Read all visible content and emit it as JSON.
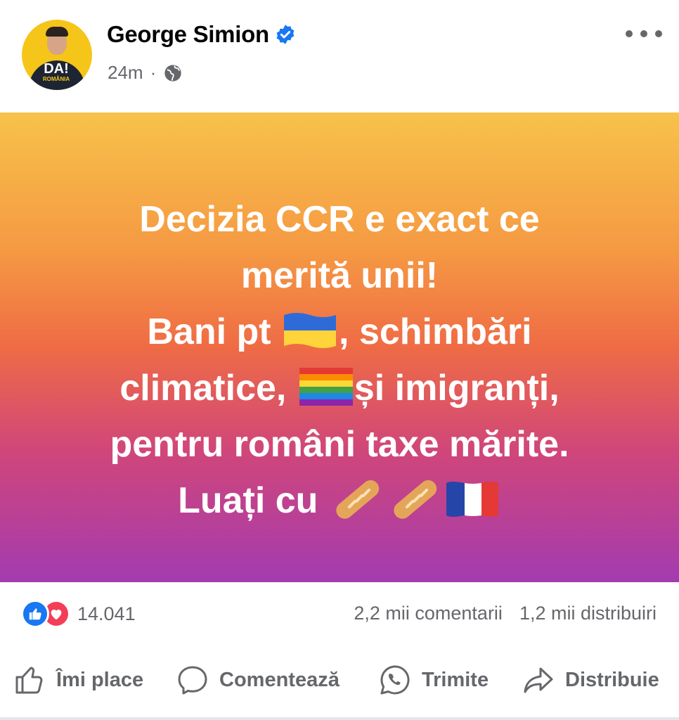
{
  "post": {
    "author": "George Simion",
    "time": "24m",
    "avatar_text": "DA!",
    "avatar_subtext": "ROMÂNIA",
    "lines": [
      "Decizia CCR e exact ce",
      "merită unii!",
      "Bani pt",
      ", schimbări",
      "climatice,",
      "și imigranți,",
      "pentru români taxe mărite.",
      "Luați cu"
    ],
    "emoji": {
      "ukraine_flag": "ukraine-flag-emoji",
      "rainbow_flag": "rainbow-flag-emoji",
      "baguette": "baguette-emoji",
      "france_flag": "france-flag-emoji"
    },
    "gradient_colors": [
      "#f7c24a",
      "#f59843",
      "#ef6b45",
      "#d0467a",
      "#a33bb0"
    ]
  },
  "engagement": {
    "reaction_count": "14.041",
    "comments": "2,2 mii comentarii",
    "shares": "1,2 mii distribuiri"
  },
  "actions": {
    "like": "Îmi place",
    "comment": "Comentează",
    "send": "Trimite",
    "share": "Distribuie"
  },
  "colors": {
    "like_blue": "#1877f2",
    "love_red": "#f33e58",
    "muted_text": "#65676b"
  }
}
